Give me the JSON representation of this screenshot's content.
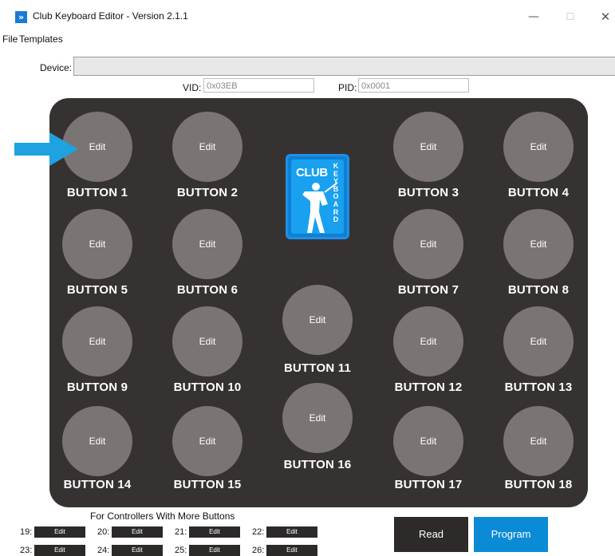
{
  "window": {
    "title": "Club Keyboard Editor - Version 2.1.1",
    "app_icon": "»",
    "minimize": "—",
    "maximize": "☐",
    "close": "✕"
  },
  "menu": {
    "items": [
      "File",
      "Templates"
    ]
  },
  "device": {
    "label": "Device:",
    "value": ""
  },
  "ids": {
    "vid_label": "VID:",
    "vid_value": "0x03EB",
    "pid_label": "PID:",
    "pid_value": "0x0001"
  },
  "logo": {
    "club": "CLUB",
    "keyboard": "KEYBOARD"
  },
  "buttons": [
    {
      "edit": "Edit",
      "label": "BUTTON 1"
    },
    {
      "edit": "Edit",
      "label": "BUTTON 2"
    },
    {
      "edit": "Edit",
      "label": "BUTTON 3"
    },
    {
      "edit": "Edit",
      "label": "BUTTON 4"
    },
    {
      "edit": "Edit",
      "label": "BUTTON 5"
    },
    {
      "edit": "Edit",
      "label": "BUTTON 6"
    },
    {
      "edit": "Edit",
      "label": "BUTTON 7"
    },
    {
      "edit": "Edit",
      "label": "BUTTON 8"
    },
    {
      "edit": "Edit",
      "label": "BUTTON 9"
    },
    {
      "edit": "Edit",
      "label": "BUTTON 10"
    },
    {
      "edit": "Edit",
      "label": "BUTTON 11"
    },
    {
      "edit": "Edit",
      "label": "BUTTON 12"
    },
    {
      "edit": "Edit",
      "label": "BUTTON 13"
    },
    {
      "edit": "Edit",
      "label": "BUTTON 14"
    },
    {
      "edit": "Edit",
      "label": "BUTTON 15"
    },
    {
      "edit": "Edit",
      "label": "BUTTON 16"
    },
    {
      "edit": "Edit",
      "label": "BUTTON 17"
    },
    {
      "edit": "Edit",
      "label": "BUTTON 18"
    }
  ],
  "extra": {
    "title": "For Controllers With More Buttons",
    "items": [
      {
        "num": "19:",
        "edit": "Edit"
      },
      {
        "num": "20:",
        "edit": "Edit"
      },
      {
        "num": "21:",
        "edit": "Edit"
      },
      {
        "num": "22:",
        "edit": "Edit"
      },
      {
        "num": "23:",
        "edit": "Edit"
      },
      {
        "num": "24:",
        "edit": "Edit"
      },
      {
        "num": "25:",
        "edit": "Edit"
      },
      {
        "num": "26:",
        "edit": "Edit"
      }
    ]
  },
  "actions": {
    "read": "Read",
    "program": "Program"
  },
  "colors": {
    "pad": "#373232",
    "button": "#7a7573",
    "accent": "#0b8bd6",
    "arrow": "#1ea3e0",
    "read_bg": "#2e2a2a",
    "program_bg": "#0b8bd6"
  }
}
